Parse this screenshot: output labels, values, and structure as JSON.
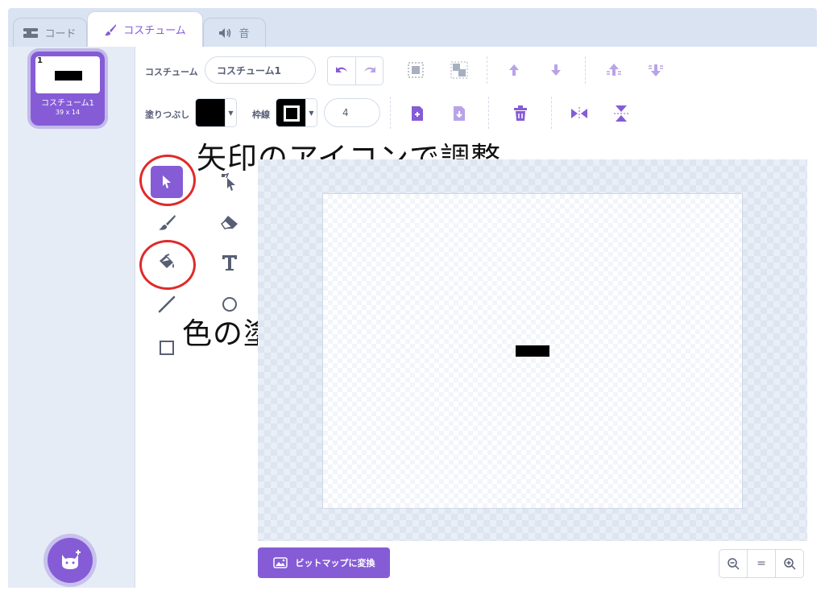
{
  "tabs": [
    {
      "label": "コード",
      "icon": "code-blocks-icon"
    },
    {
      "label": "コスチューム",
      "icon": "brush-icon"
    },
    {
      "label": "音",
      "icon": "speaker-icon"
    }
  ],
  "costume_list": {
    "items": [
      {
        "number": "1",
        "name": "コスチューム1",
        "size": "39 x 14"
      }
    ],
    "add_button_icon": "cat-add-icon"
  },
  "toolbar": {
    "costume_label": "コスチューム",
    "costume_name": "コスチューム1",
    "fill_label": "塗りつぶし",
    "fill_color": "#000000",
    "outline_label": "枠線",
    "outline_color": "#000000",
    "outline_width": "4"
  },
  "tools": [
    "select-icon",
    "reshape-icon",
    "brush-icon",
    "eraser-icon",
    "fill-bucket-icon",
    "text-tool-icon",
    "line-icon",
    "circle-icon",
    "rectangle-icon"
  ],
  "annotations": {
    "arrow_note": "矢印のアイコンで調整",
    "fill_note": "色の塗りつぶし"
  },
  "bottom": {
    "convert_label": "ビットマップに変換",
    "zoom_out": "−",
    "zoom_reset": "=",
    "zoom_in": "+"
  },
  "colors": {
    "accent": "#855cd6",
    "annotation_circle": "#e02a2a"
  }
}
